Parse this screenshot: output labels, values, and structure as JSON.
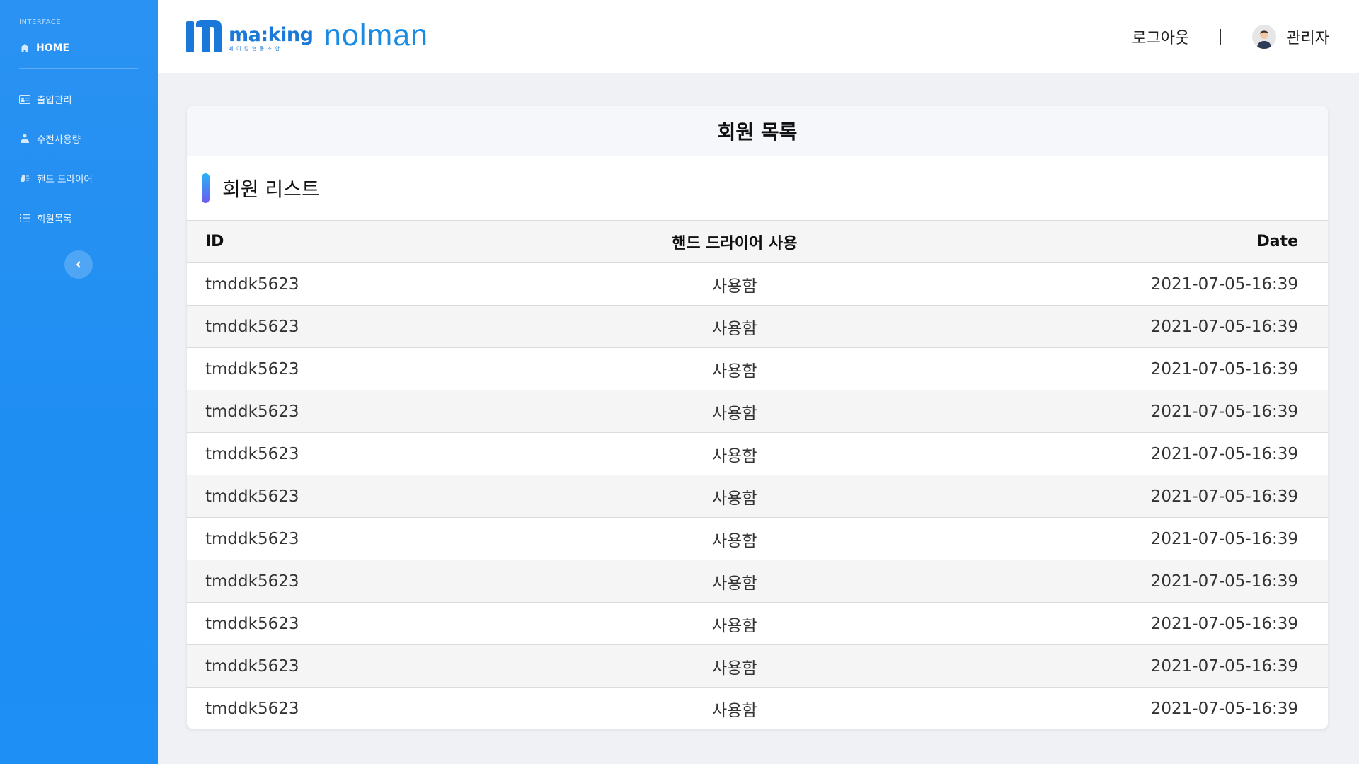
{
  "colors": {
    "sidebar": "#1e8ef3",
    "brand_blue": "#1a78d9",
    "accent_gradient_top": "#28b4f5",
    "accent_gradient_bottom": "#6a5af0"
  },
  "sidebar": {
    "heading": "INTERFACE",
    "home": {
      "label": "HOME",
      "icon": "home-icon"
    },
    "items": [
      {
        "label": "출입관리",
        "icon": "id-card-icon"
      },
      {
        "label": "수전사용량",
        "icon": "hand-water-icon"
      },
      {
        "label": "핸드 드라이어",
        "icon": "hand-dryer-icon"
      },
      {
        "label": "회원목록",
        "icon": "list-icon"
      }
    ],
    "toggle_icon": "chevron-left-icon"
  },
  "header": {
    "logo_making": "ma:king",
    "logo_making_sub": "메이킹협동조합",
    "logo_nolman": "nolman",
    "logout": "로그아웃",
    "admin": "관리자"
  },
  "card": {
    "title": "회원 목록",
    "section_title": "회원 리스트",
    "columns": [
      "ID",
      "핸드 드라이어 사용",
      "Date"
    ],
    "rows": [
      [
        "tmddk5623",
        "사용함",
        "2021-07-05-16:39"
      ],
      [
        "tmddk5623",
        "사용함",
        "2021-07-05-16:39"
      ],
      [
        "tmddk5623",
        "사용함",
        "2021-07-05-16:39"
      ],
      [
        "tmddk5623",
        "사용함",
        "2021-07-05-16:39"
      ],
      [
        "tmddk5623",
        "사용함",
        "2021-07-05-16:39"
      ],
      [
        "tmddk5623",
        "사용함",
        "2021-07-05-16:39"
      ],
      [
        "tmddk5623",
        "사용함",
        "2021-07-05-16:39"
      ],
      [
        "tmddk5623",
        "사용함",
        "2021-07-05-16:39"
      ],
      [
        "tmddk5623",
        "사용함",
        "2021-07-05-16:39"
      ],
      [
        "tmddk5623",
        "사용함",
        "2021-07-05-16:39"
      ],
      [
        "tmddk5623",
        "사용함",
        "2021-07-05-16:39"
      ]
    ]
  }
}
